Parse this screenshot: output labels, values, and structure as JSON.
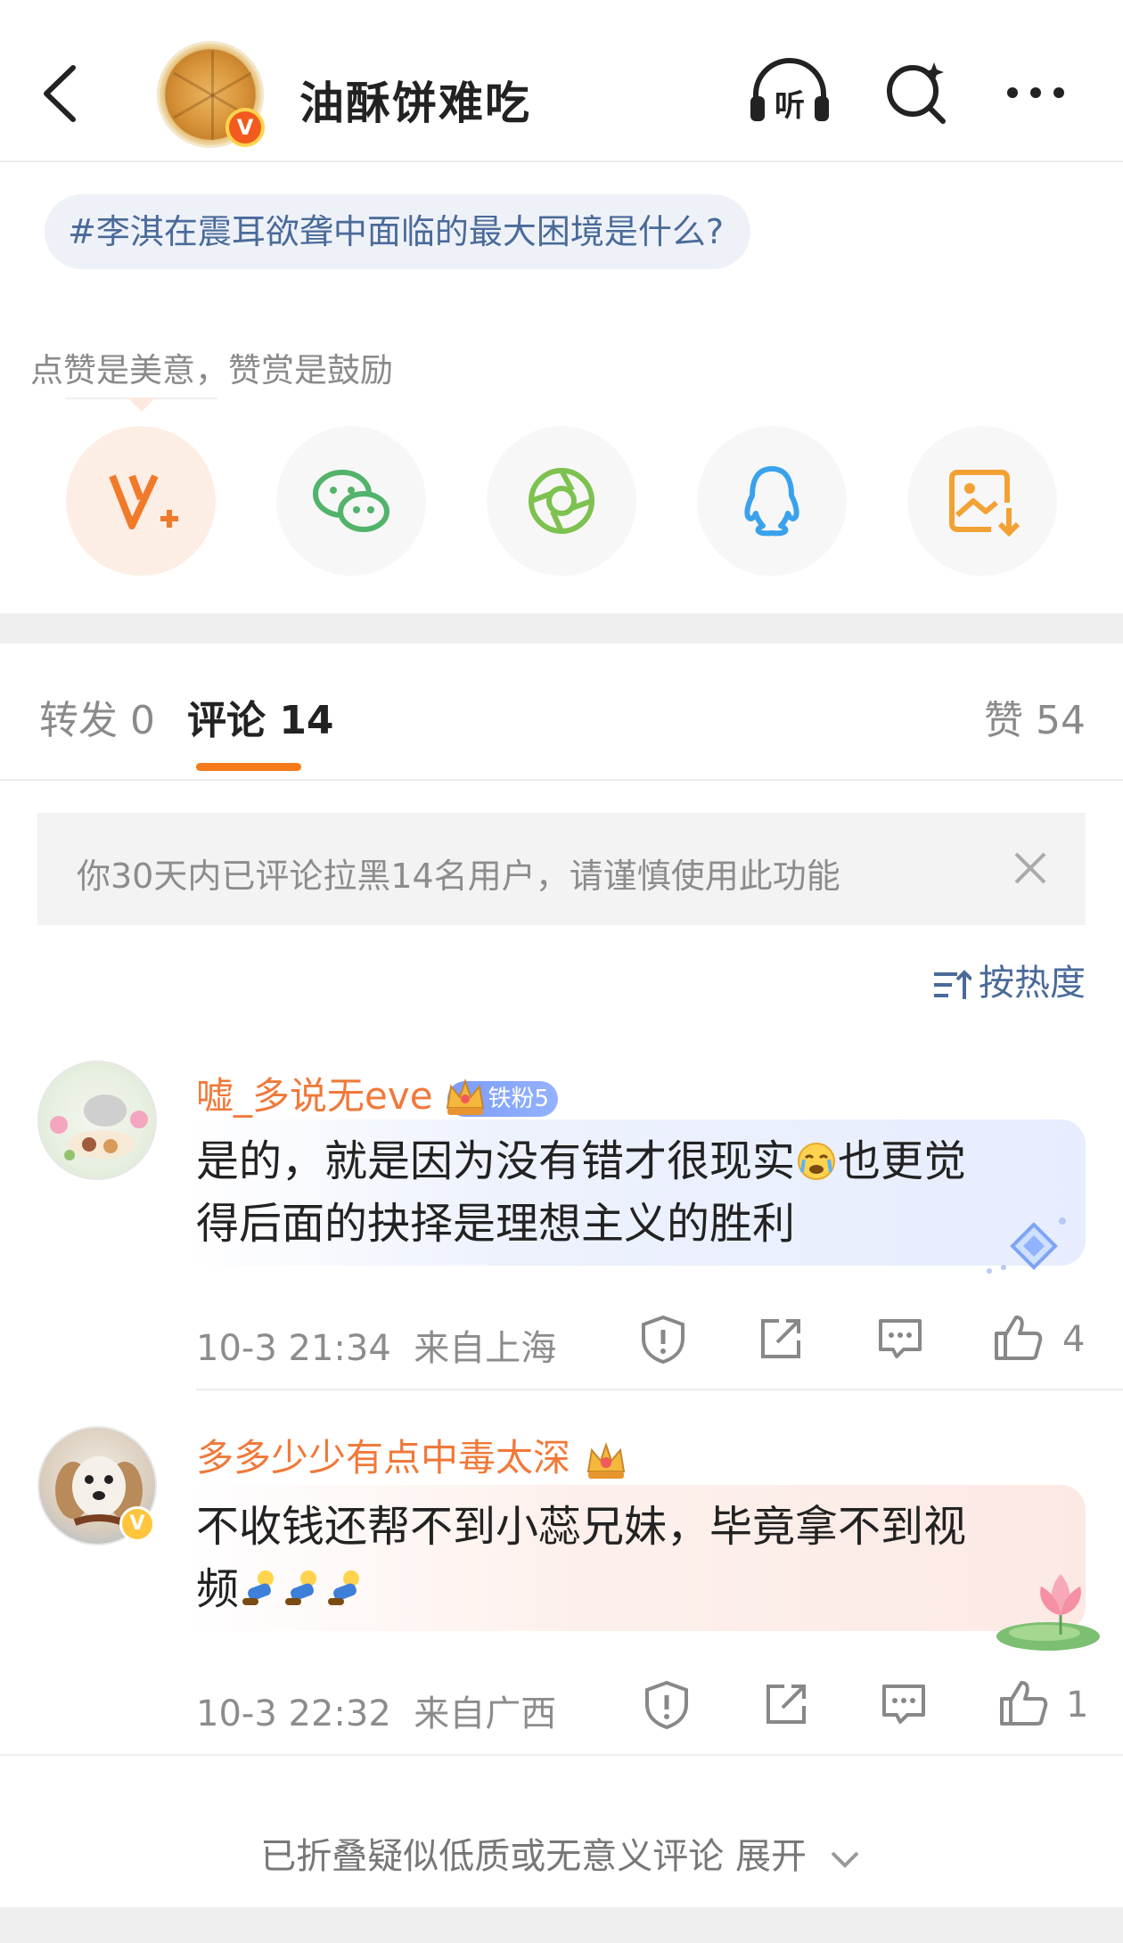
{
  "header": {
    "title": "油酥饼难吃",
    "verified_badge": "V",
    "listen_icon_label": "听",
    "icons": [
      "back-arrow-icon",
      "headphones-icon",
      "search-icon",
      "more-icon"
    ]
  },
  "topic": {
    "text": "#李淇在震耳欲聋中面临的最大困境是什么?"
  },
  "reward": {
    "tip": "点赞是美意，赞赏是鼓励"
  },
  "share": {
    "buttons": [
      "v-plus-icon",
      "wechat-icon",
      "moments-icon",
      "qq-icon",
      "save-image-icon"
    ]
  },
  "tabs": {
    "repost": "转发 0",
    "comments": "评论 14",
    "likes": "赞 54"
  },
  "notice": {
    "text": "你30天内已评论拉黑14名用户，请谨慎使用此功能"
  },
  "sort": {
    "label": "按热度"
  },
  "comments": [
    {
      "name": "嘘_多说无eve",
      "badge": "铁粉5",
      "text_line1": "是的，就是因为没有错才很现实",
      "text_line1b": "也更觉",
      "text_line2": "得后面的抉择是理想主义的胜利",
      "time": "10-3 21:34",
      "location": "来自上海",
      "likes": "4"
    },
    {
      "name": "多多少少有点中毒太深",
      "text_line1": "不收钱还帮不到小蕊兄妹，毕竟拿不到视",
      "text_line2": "频",
      "time": "10-3 22:32",
      "location": "来自广西",
      "likes": "1"
    }
  ],
  "folded": {
    "text": "已折叠疑似低质或无意义评论 展开"
  },
  "colors": {
    "accent_orange": "#f57a19",
    "link_blue": "#4a6a99",
    "name_orange": "#f0793a"
  }
}
